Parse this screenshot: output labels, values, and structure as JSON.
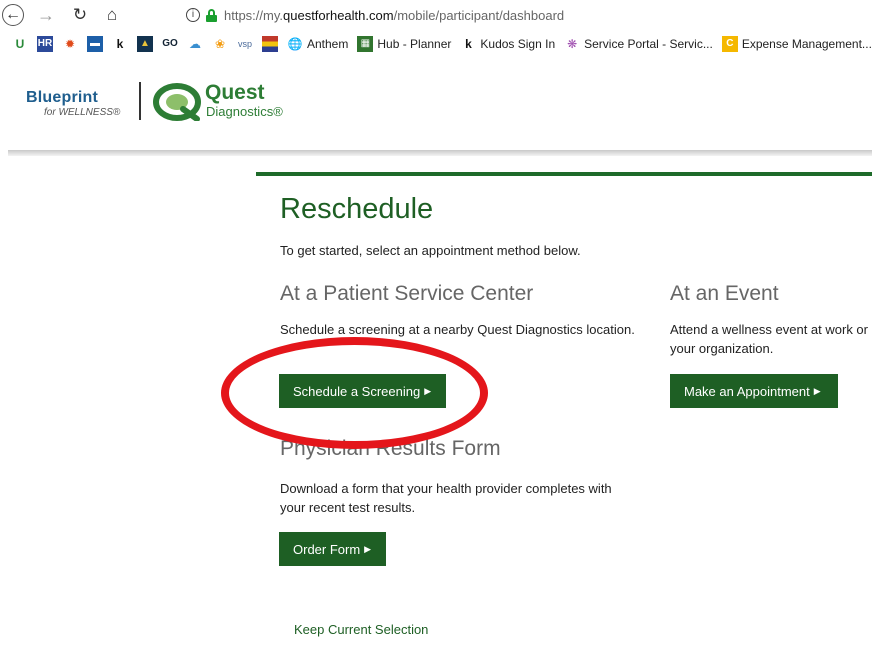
{
  "browser": {
    "url_prefix": "https://my.",
    "url_domain": "questforhealth.com",
    "url_path": "/mobile/participant/dashboard",
    "bookmarks": [
      {
        "label": "Anthem",
        "icon": "globe-icon"
      },
      {
        "label": "Hub - Planner",
        "icon": "planner-icon"
      },
      {
        "label": "Kudos Sign In",
        "icon": "kudos-icon"
      },
      {
        "label": "Service Portal - Servic...",
        "icon": "service-portal-icon"
      },
      {
        "label": "Expense Management...",
        "icon": "expense-icon"
      }
    ],
    "icon_bookmarks": [
      "GO",
      "vsp"
    ]
  },
  "header": {
    "blueprint_title": "Blueprint",
    "blueprint_sub": "for WELLNESS®",
    "quest_name": "Quest",
    "quest_sub": "Diagnostics®"
  },
  "main": {
    "title": "Reschedule",
    "intro": "To get started, select an appointment method below.",
    "psc": {
      "title": "At a Patient Service Center",
      "desc": "Schedule a screening at a nearby Quest Diagnostics location.",
      "button": "Schedule a Screening"
    },
    "event": {
      "title": "At an Event",
      "desc_line1": "Attend a wellness event at work or",
      "desc_line2": "your organization.",
      "button": "Make an Appointment"
    },
    "physician": {
      "title": "Physician Results Form",
      "desc_line1": "Download a form that your health provider completes with",
      "desc_line2": "your recent test results.",
      "button": "Order Form"
    },
    "keep_link": "Keep Current Selection"
  },
  "colors": {
    "brand_green": "#1e5f24",
    "annotation_red": "#e4161b",
    "blueprint_blue": "#1f5e8e"
  }
}
